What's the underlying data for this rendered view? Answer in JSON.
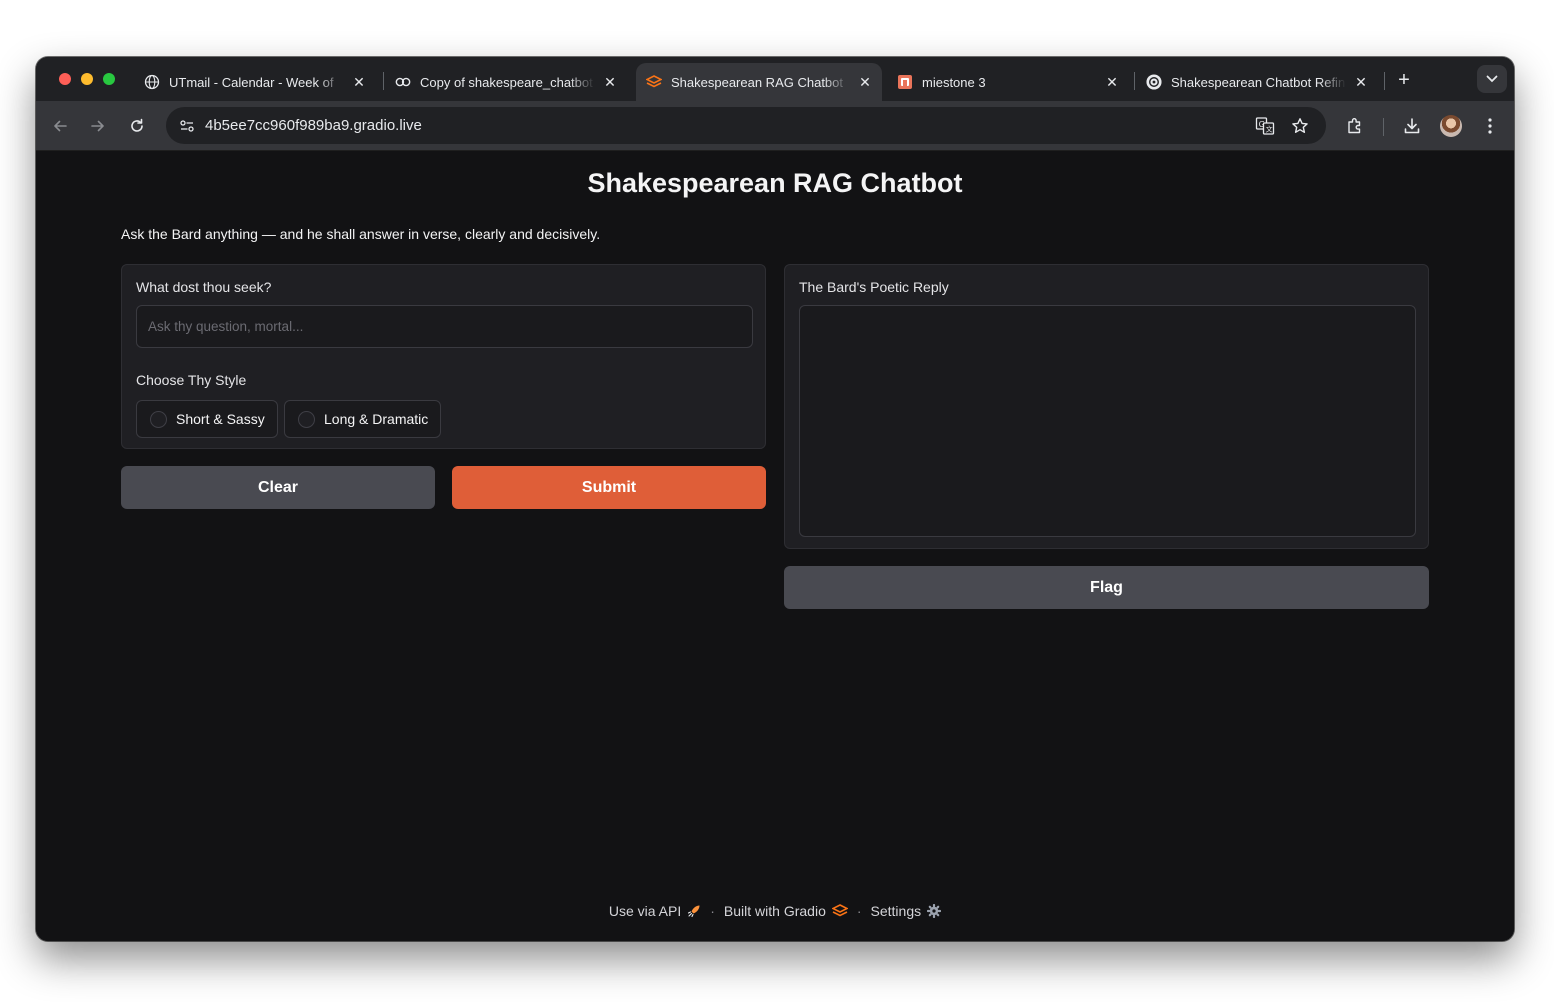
{
  "browser": {
    "tabs": [
      {
        "title": "UTmail - Calendar - Week of",
        "icon": "globe-icon",
        "active": false
      },
      {
        "title": "Copy of shakespeare_chatbot",
        "icon": "colab-icon",
        "active": false
      },
      {
        "title": "Shakespearean RAG Chatbot",
        "icon": "gradio-icon",
        "active": true
      },
      {
        "title": "miestone 3",
        "icon": "document-icon",
        "active": false
      },
      {
        "title": "Shakespearean Chatbot Refinement",
        "icon": "openai-icon",
        "active": false
      }
    ],
    "url": "4b5ee7cc960f989ba9.gradio.live"
  },
  "app": {
    "title": "Shakespearean RAG Chatbot",
    "description": "Ask the Bard anything — and he shall answer in verse, clearly and decisively.",
    "input_panel": {
      "question_label": "What dost thou seek?",
      "question_placeholder": "Ask thy question, mortal...",
      "question_value": "",
      "style_label": "Choose Thy Style",
      "style_options": [
        "Short & Sassy",
        "Long & Dramatic"
      ],
      "style_selected": null
    },
    "buttons": {
      "clear": "Clear",
      "submit": "Submit",
      "flag": "Flag"
    },
    "output_panel": {
      "label": "The Bard's Poetic Reply",
      "value": ""
    },
    "footer": {
      "api": "Use via API",
      "built": "Built with Gradio",
      "settings": "Settings"
    }
  },
  "colors": {
    "primary_button": "#df5e38",
    "secondary_button": "#494a51",
    "page_background": "#121214"
  }
}
